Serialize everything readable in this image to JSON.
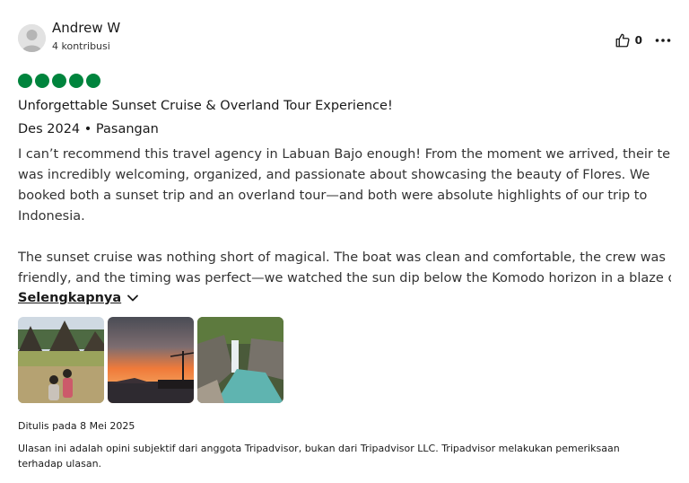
{
  "review": {
    "user": {
      "name": "Andrew W",
      "contributions": "4 kontribusi",
      "avatar_icon": "default-avatar-icon"
    },
    "helpful_count": "0",
    "rating": 5,
    "rating_color": "#00843d",
    "title": "Unforgettable Sunset Cruise & Overland Tour Experience!",
    "meta": "Des 2024 • Pasangan",
    "body_lines": [
      "I can’t recommend this travel agency in Labuan Bajo enough! From the moment we arrived, their team",
      "was incredibly welcoming, organized, and passionate about showcasing the beauty of Flores. We",
      "booked both a sunset trip and an overland tour—and both were absolute highlights of our trip to",
      "Indonesia.",
      "The sunset cruise was nothing short of magical. The boat was clean and comfortable, the crew was",
      "friendly, and the timing was perfect—we watched the sun dip below the Komodo horizon in a blaze of…"
    ],
    "read_more": "Selengkapnya",
    "photos": [
      "village-couple-photo",
      "sunset-boat-photo",
      "waterfall-canyon-photo"
    ],
    "written_date": "Ditulis pada 8 Mei 2025",
    "disclaimer": "Ulasan ini adalah opini subjektif dari anggota Tripadvisor, bukan dari Tripadvisor LLC. Tripadvisor melakukan pemeriksaan terhadap ulasan."
  }
}
